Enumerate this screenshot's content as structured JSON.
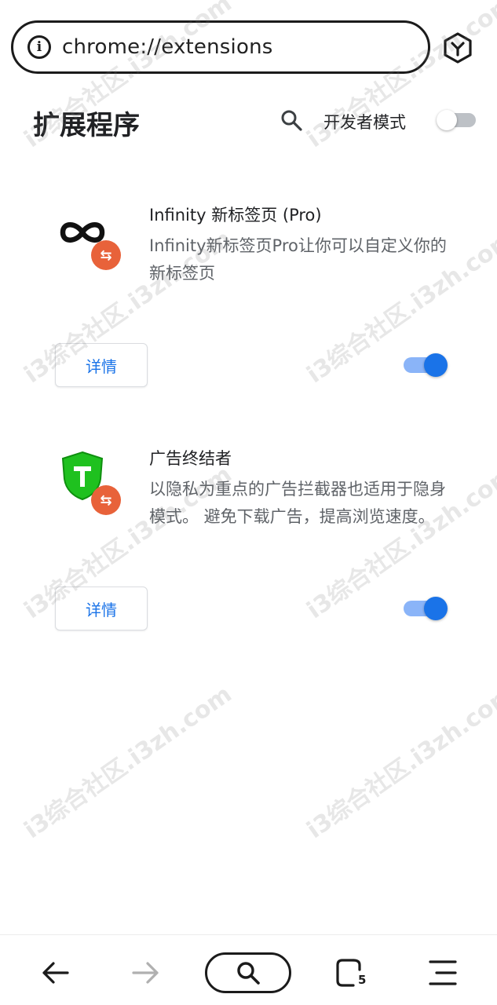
{
  "address_bar": {
    "url": "chrome://extensions"
  },
  "header": {
    "title": "扩展程序",
    "dev_mode_label": "开发者模式",
    "dev_mode_on": false
  },
  "extensions": [
    {
      "name": "Infinity 新标签页 (Pro)",
      "description": "Infinity新标签页Pro让你可以自定义你的新标签页",
      "details_label": "详情",
      "enabled": true,
      "icon": "infinity-icon"
    },
    {
      "name": "广告终结者",
      "description": "以隐私为重点的广告拦截器也适用于隐身模式。 避免下载广告，提高浏览速度。",
      "details_label": "详情",
      "enabled": true,
      "icon": "green-shield-t-icon"
    }
  ],
  "bottom_nav": {
    "tab_count": "5"
  },
  "watermark": {
    "text": "i3综合社区.i3zh.com"
  },
  "colors": {
    "accent": "#1a73e8",
    "accent_light": "#8ab4f8",
    "badge": "#e8623a",
    "shield": "#1fc11f"
  }
}
